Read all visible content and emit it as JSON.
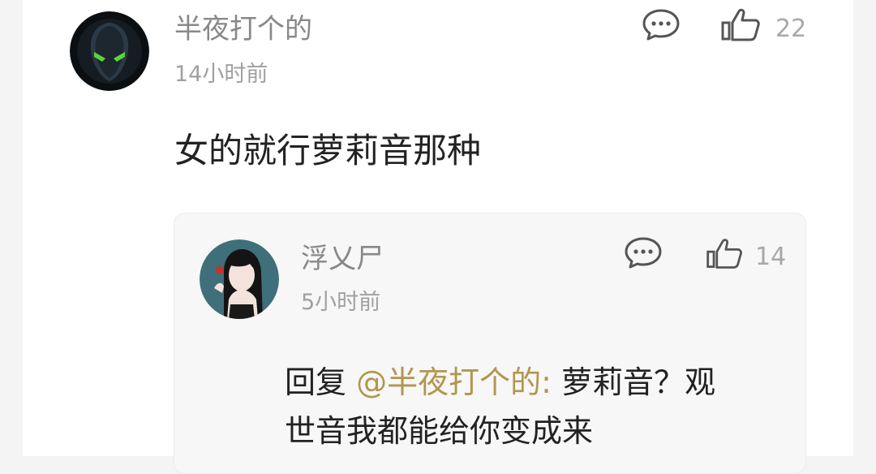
{
  "comment": {
    "username": "半夜打个的",
    "time": "14小时前",
    "like_count": "22",
    "text": "女的就行萝莉音那种"
  },
  "reply": {
    "username": "浮乂尸",
    "time": "5小时前",
    "like_count": "14",
    "prefix": "回复 ",
    "mention": "@半夜打个的:",
    "text_line1": " 萝莉音？观",
    "text_line2": "世音我都能给你变成来"
  },
  "colors": {
    "username": "#888888",
    "mention": "#b29650",
    "text": "#222222",
    "reply_background": "#f7f7f7"
  },
  "icons": [
    "comment-bubble-icon",
    "thumbs-up-icon"
  ]
}
